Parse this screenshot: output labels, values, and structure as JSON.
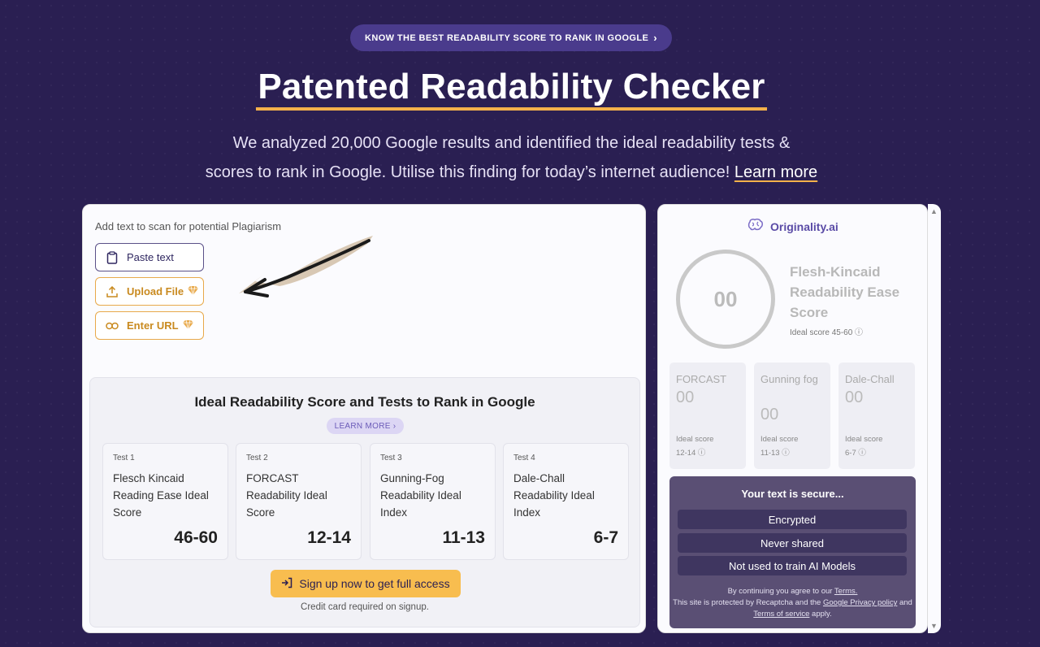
{
  "top_pill": {
    "label": "KNOW THE BEST READABILITY SCORE TO RANK IN GOOGLE",
    "chevron": "›"
  },
  "hero": {
    "title": "Patented Readability Checker",
    "subtitle_line1": "We analyzed 20,000 Google results and identified the ideal readability tests &",
    "subtitle_line2": "scores to rank in Google. Utilise this finding for today’s internet audience!",
    "learn_more": "Learn more"
  },
  "input_panel": {
    "label": "Add text to scan for potential Plagiarism",
    "paste": "Paste text",
    "upload": "Upload File",
    "url": "Enter URL"
  },
  "ideal": {
    "title": "Ideal Readability Score and Tests to Rank in Google",
    "learn_more": "LEARN MORE ›",
    "tests": [
      {
        "num": "Test 1",
        "name": "Flesch Kincaid Reading Ease Ideal Score",
        "value": "46-60"
      },
      {
        "num": "Test 2",
        "name": "FORCAST Readability Ideal Score",
        "value": "12-14"
      },
      {
        "num": "Test 3",
        "name": "Gunning-Fog Readability Ideal Index",
        "value": "11-13"
      },
      {
        "num": "Test 4",
        "name": "Dale-Chall Readability Ideal Index",
        "value": "6-7"
      }
    ],
    "signup": "Sign up now to get full access",
    "cc_note": "Credit card required on signup."
  },
  "scores": {
    "brand": "Originality.ai",
    "main_value": "00",
    "main_title": "Flesh-Kincaid Readability Ease Score",
    "main_ideal": "Ideal score 45-60 ⓘ",
    "mini": [
      {
        "name": "FORCAST",
        "value": "00",
        "ideal_label": "Ideal score",
        "ideal_range": "12-14 ⓘ"
      },
      {
        "name": "Gunning fog",
        "value": "00",
        "ideal_label": "Ideal score",
        "ideal_range": "11-13 ⓘ"
      },
      {
        "name": "Dale-Chall",
        "value": "00",
        "ideal_label": "Ideal score",
        "ideal_range": "6-7 ⓘ"
      }
    ]
  },
  "secure": {
    "title": "Your text is secure...",
    "items": [
      "Encrypted",
      "Never shared",
      "Not used to train AI Models"
    ],
    "fine_1": "By continuing you agree to our ",
    "terms": "Terms.",
    "fine_2": "This site is protected by Recaptcha and the ",
    "privacy": "Google Privacy policy",
    "fine_3": " and ",
    "tos": "Terms of service",
    "fine_4": " apply."
  },
  "colors": {
    "background": "#2a1f52",
    "accent": "#f3b14a",
    "brand": "#5a4ba6"
  }
}
